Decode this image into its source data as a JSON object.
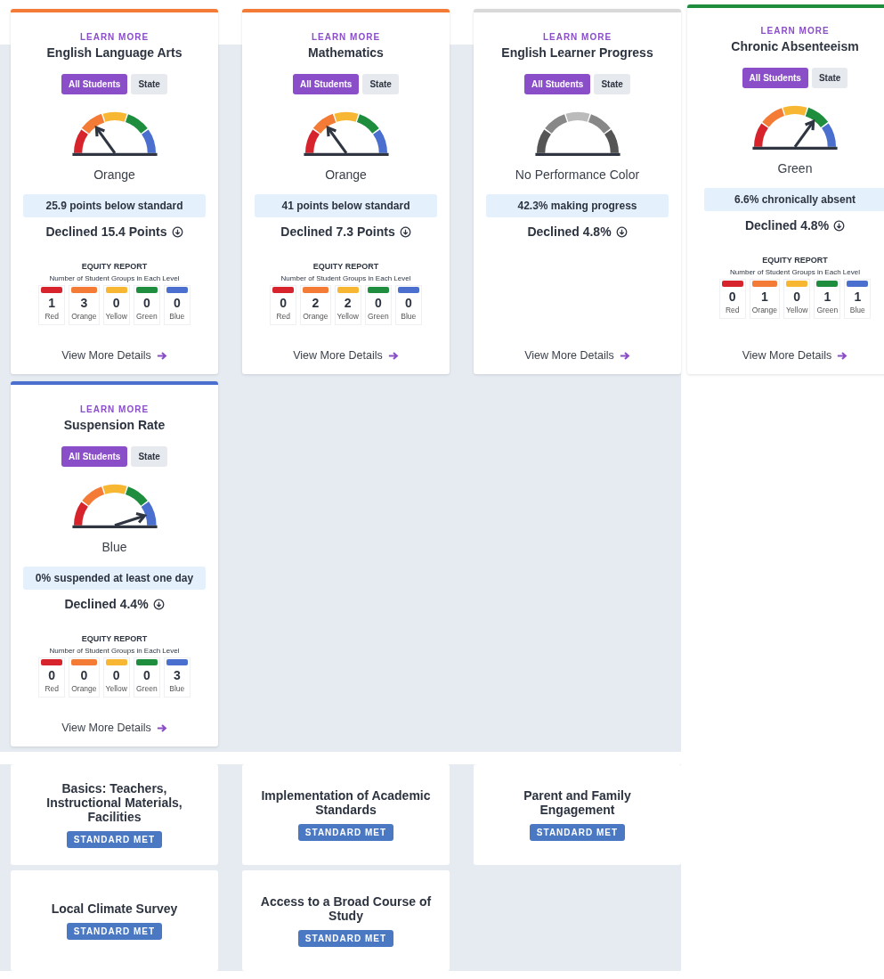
{
  "indicators": [
    {
      "learn_more": "LEARN MORE",
      "title": "English Language Arts",
      "color": "#f47b35",
      "tabs": [
        {
          "label": "All Students",
          "selected": true
        },
        {
          "label": "State",
          "selected": false
        }
      ],
      "gauge": {
        "kind": "colored",
        "segments": [
          {
            "selected": false
          },
          {
            "selected": true
          },
          {
            "selected": false
          },
          {
            "selected": false
          },
          {
            "selected": false
          }
        ]
      },
      "status": "Orange",
      "summary": "25.9 points below standard",
      "change": "Declined 15.4 Points",
      "equity": {
        "title": "EQUITY REPORT",
        "subtitle": "Number of Student Groups in Each Level",
        "levels": [
          {
            "count": "1",
            "label": "Red",
            "color": "#d7242c"
          },
          {
            "count": "3",
            "label": "Orange",
            "color": "#f47b35"
          },
          {
            "count": "0",
            "label": "Yellow",
            "color": "#f7b733"
          },
          {
            "count": "0",
            "label": "Green",
            "color": "#1e8e3e"
          },
          {
            "count": "0",
            "label": "Blue",
            "color": "#4a6fcf"
          }
        ]
      },
      "link": "View More Details"
    },
    {
      "learn_more": "LEARN MORE",
      "title": "Mathematics",
      "color": "#f47b35",
      "tabs": [
        {
          "label": "All Students",
          "selected": true
        },
        {
          "label": "State",
          "selected": false
        }
      ],
      "gauge": {
        "kind": "colored",
        "segments": [
          {
            "selected": false
          },
          {
            "selected": true
          },
          {
            "selected": false
          },
          {
            "selected": false
          },
          {
            "selected": false
          }
        ]
      },
      "status": "Orange",
      "summary": "41 points below standard",
      "change": "Declined 7.3 Points",
      "equity": {
        "title": "EQUITY REPORT",
        "subtitle": "Number of Student Groups in Each Level",
        "levels": [
          {
            "count": "0",
            "label": "Red",
            "color": "#d7242c"
          },
          {
            "count": "2",
            "label": "Orange",
            "color": "#f47b35"
          },
          {
            "count": "2",
            "label": "Yellow",
            "color": "#f7b733"
          },
          {
            "count": "0",
            "label": "Green",
            "color": "#1e8e3e"
          },
          {
            "count": "0",
            "label": "Blue",
            "color": "#4a6fcf"
          }
        ]
      },
      "link": "View More Details"
    },
    {
      "learn_more": "LEARN MORE",
      "title": "English Learner Progress",
      "color": "#d9d9d9",
      "tabs": [
        {
          "label": "All Students",
          "selected": true
        },
        {
          "label": "State",
          "selected": false
        }
      ],
      "gauge": {
        "kind": "no_color",
        "segments": [
          {
            "selected": false
          },
          {
            "selected": false
          },
          {
            "selected": false
          },
          {
            "selected": false
          },
          {
            "selected": false
          }
        ]
      },
      "status": "No Performance Color",
      "summary": "42.3% making progress",
      "change": "Declined 4.8%",
      "link": "View More Details"
    },
    {
      "learn_more": "LEARN MORE",
      "title": "Chronic Absenteeism",
      "color": "#1e8e3e",
      "tabs": [
        {
          "label": "All Students",
          "selected": true
        },
        {
          "label": "State",
          "selected": false
        }
      ],
      "gauge": {
        "kind": "colored",
        "segments": [
          {
            "selected": false
          },
          {
            "selected": false
          },
          {
            "selected": false
          },
          {
            "selected": true
          },
          {
            "selected": false
          }
        ]
      },
      "status": "Green",
      "summary": "6.6% chronically absent",
      "change": "Declined 4.8%",
      "equity": {
        "title": "EQUITY REPORT",
        "subtitle": "Number of Student Groups in Each Level",
        "levels": [
          {
            "count": "0",
            "label": "Red",
            "color": "#d7242c"
          },
          {
            "count": "1",
            "label": "Orange",
            "color": "#f47b35"
          },
          {
            "count": "0",
            "label": "Yellow",
            "color": "#f7b733"
          },
          {
            "count": "1",
            "label": "Green",
            "color": "#1e8e3e"
          },
          {
            "count": "1",
            "label": "Blue",
            "color": "#4a6fcf"
          }
        ]
      },
      "link": "View More Details"
    },
    {
      "learn_more": "LEARN MORE",
      "title": "Suspension Rate",
      "color": "#4a6fcf",
      "tabs": [
        {
          "label": "All Students",
          "selected": true
        },
        {
          "label": "State",
          "selected": false
        }
      ],
      "gauge": {
        "kind": "colored",
        "segments": [
          {
            "selected": false
          },
          {
            "selected": false
          },
          {
            "selected": false
          },
          {
            "selected": false
          },
          {
            "selected": true
          }
        ]
      },
      "status": "Blue",
      "summary": "0% suspended at least one day",
      "change": "Declined 4.4%",
      "equity": {
        "title": "EQUITY REPORT",
        "subtitle": "Number of Student Groups in Each Level",
        "levels": [
          {
            "count": "0",
            "label": "Red",
            "color": "#d7242c"
          },
          {
            "count": "0",
            "label": "Orange",
            "color": "#f47b35"
          },
          {
            "count": "0",
            "label": "Yellow",
            "color": "#f7b733"
          },
          {
            "count": "0",
            "label": "Green",
            "color": "#1e8e3e"
          },
          {
            "count": "3",
            "label": "Blue",
            "color": "#4a6fcf"
          }
        ]
      },
      "link": "View More Details"
    }
  ],
  "local_indicators": [
    {
      "title": "Basics: Teachers, Instructional Materials, Facilities",
      "badge": "STANDARD MET"
    },
    {
      "title": "Implementation of Academic Standards",
      "badge": "STANDARD MET"
    },
    {
      "title": "Parent and Family Engagement",
      "badge": "STANDARD MET"
    },
    {
      "title": "Local Climate Survey",
      "badge": "STANDARD MET"
    },
    {
      "title": "Access to a Broad Course of Study",
      "badge": "STANDARD MET"
    }
  ]
}
